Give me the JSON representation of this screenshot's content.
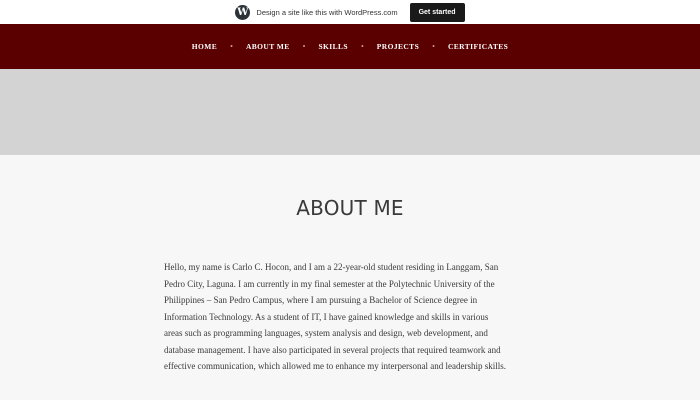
{
  "wp_banner": {
    "logo_glyph": "W",
    "text": "Design a site like this with WordPress.com",
    "cta_label": "Get started"
  },
  "nav": {
    "items": [
      {
        "label": "HOME"
      },
      {
        "label": "ABOUT ME"
      },
      {
        "label": "SKILLS"
      },
      {
        "label": "PROJECTS"
      },
      {
        "label": "CERTIFICATES"
      }
    ],
    "separator": "•"
  },
  "page": {
    "title": "ABOUT ME",
    "paragraph": "Hello, my name is Carlo C. Hocon, and I am a 22-year-old student residing in Langgam, San Pedro City, Laguna. I am currently in my final semester at the Polytechnic University of the Philippines – San Pedro Campus, where I am pursuing a Bachelor of Science degree in Information Technology. As a student of IT, I have gained knowledge and skills in various areas such as programming languages, system analysis and design, web development, and database management. I have also participated in several projects that required teamwork and effective communication, which allowed me to enhance my interpersonal and leadership skills."
  },
  "colors": {
    "nav_background": "#5a0000",
    "hero_background": "#d3d3d3",
    "page_background": "#f7f7f7"
  }
}
